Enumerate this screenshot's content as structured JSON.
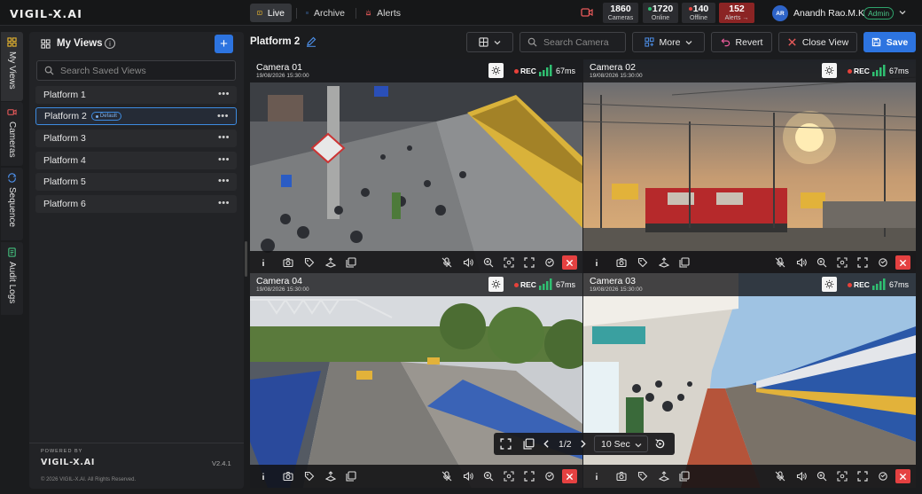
{
  "app": {
    "logo": "VIGIL-X.AI"
  },
  "nav": {
    "tabs": [
      {
        "label": "Live"
      },
      {
        "label": "Archive"
      },
      {
        "label": "Alerts"
      }
    ]
  },
  "stats": {
    "cameras": {
      "value": "1860",
      "label": "Cameras"
    },
    "online": {
      "value": "1720",
      "label": "Online",
      "color": "#2fbf71"
    },
    "offline": {
      "value": "140",
      "label": "Offline",
      "color": "#e5443f"
    },
    "alerts": {
      "value": "152",
      "label": "Alerts →"
    }
  },
  "user": {
    "initials": "AR",
    "name": "Anandh Rao.M.K",
    "role": "Admin"
  },
  "rail": {
    "items": [
      {
        "label": "My Views"
      },
      {
        "label": "Cameras"
      },
      {
        "label": "Sequence"
      },
      {
        "label": "Audit Logs"
      }
    ]
  },
  "sidebar": {
    "title": "My Views",
    "info": "i",
    "add": "+",
    "search_placeholder": "Search Saved Views",
    "views": [
      {
        "label": "Platform 1"
      },
      {
        "label": "Platform 2",
        "badge": "Default"
      },
      {
        "label": "Platform 3"
      },
      {
        "label": "Platform 4"
      },
      {
        "label": "Platform 5"
      },
      {
        "label": "Platform 6"
      }
    ],
    "more": "•••",
    "footer": {
      "powered": "POWERED BY",
      "brand": "VIGIL-X.AI",
      "version": "V2.4.1",
      "copyright": "© 2026 VIGIL-X.AI. All Rights Reserved."
    }
  },
  "toolbar": {
    "view_title": "Platform 2",
    "search_placeholder": "Search Camera",
    "more": "More",
    "revert": "Revert",
    "close": "Close View",
    "save": "Save"
  },
  "cameras": [
    {
      "name": "Camera 01",
      "timestamp": "19/08/2026 15:30:00",
      "rec": "REC",
      "latency": "67ms"
    },
    {
      "name": "Camera 02",
      "timestamp": "19/08/2026 15:30:00",
      "rec": "REC",
      "latency": "67ms"
    },
    {
      "name": "Camera 04",
      "timestamp": "19/08/2026 15:30:00",
      "rec": "REC",
      "latency": "67ms"
    },
    {
      "name": "Camera 03",
      "timestamp": "19/08/2026 15:30:00",
      "rec": "REC",
      "latency": "67ms"
    }
  ],
  "pager": {
    "page": "1/2",
    "interval": "10 Sec"
  },
  "colors": {
    "accent": "#2d74e0",
    "alert_bg": "#8b2424",
    "close_red": "#e54141",
    "signal": "#2fbf71"
  }
}
